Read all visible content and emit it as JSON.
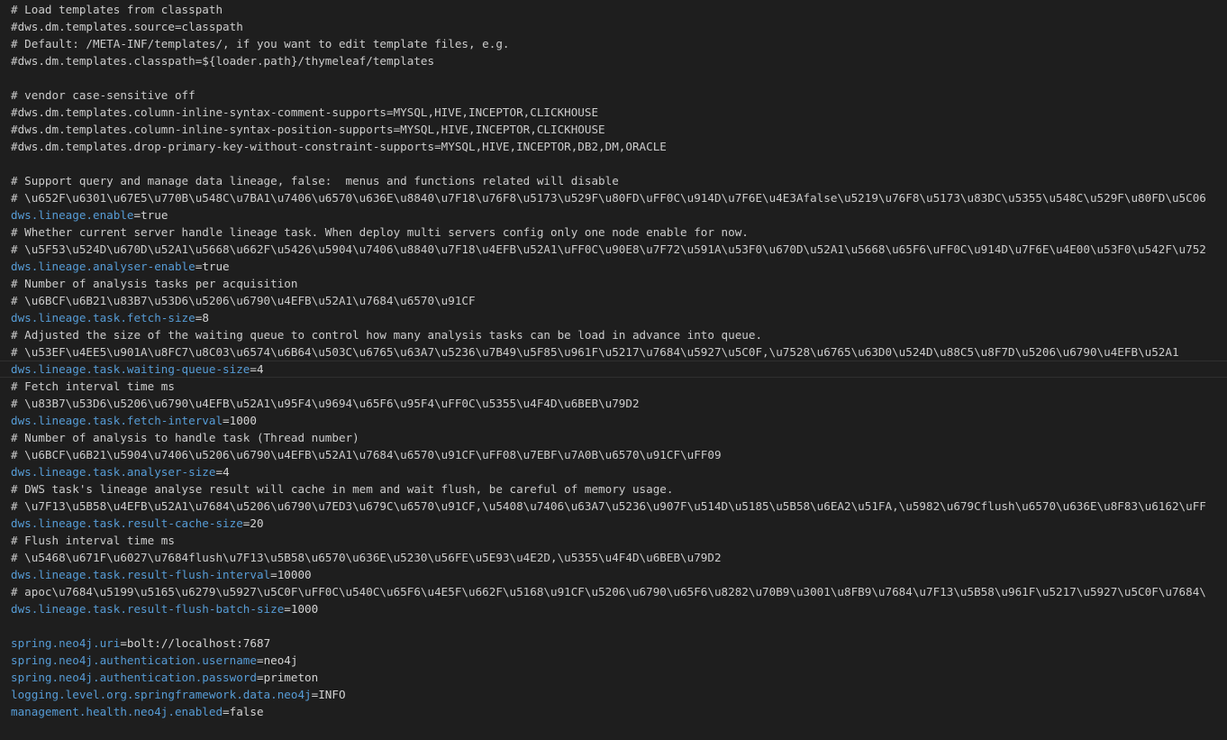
{
  "editor": {
    "colors": {
      "background": "#1e1e1e",
      "comment": "#cccccc",
      "key": "#569cd6",
      "value": "#d4d4d4"
    },
    "lines": [
      {
        "type": "comment",
        "text": "# Load templates from classpath"
      },
      {
        "type": "comment",
        "text": "#dws.dm.templates.source=classpath"
      },
      {
        "type": "comment",
        "text": "# Default: /META-INF/templates/, if you want to edit template files, e.g."
      },
      {
        "type": "comment",
        "text": "#dws.dm.templates.classpath=${loader.path}/thymeleaf/templates"
      },
      {
        "type": "blank",
        "text": ""
      },
      {
        "type": "comment",
        "text": "# vendor case-sensitive off"
      },
      {
        "type": "comment",
        "text": "#dws.dm.templates.column-inline-syntax-comment-supports=MYSQL,HIVE,INCEPTOR,CLICKHOUSE"
      },
      {
        "type": "comment",
        "text": "#dws.dm.templates.column-inline-syntax-position-supports=MYSQL,HIVE,INCEPTOR,CLICKHOUSE"
      },
      {
        "type": "comment",
        "text": "#dws.dm.templates.drop-primary-key-without-constraint-supports=MYSQL,HIVE,INCEPTOR,DB2,DM,ORACLE"
      },
      {
        "type": "blank",
        "text": ""
      },
      {
        "type": "comment",
        "text": "# Support query and manage data lineage, false:  menus and functions related will disable"
      },
      {
        "type": "comment",
        "text": "# \\u652F\\u6301\\u67E5\\u770B\\u548C\\u7BA1\\u7406\\u6570\\u636E\\u8840\\u7F18\\u76F8\\u5173\\u529F\\u80FD\\uFF0C\\u914D\\u7F6E\\u4E3Afalse\\u5219\\u76F8\\u5173\\u83DC\\u5355\\u548C\\u529F\\u80FD\\u5C06"
      },
      {
        "type": "prop",
        "key": "dws.lineage.enable",
        "value": "true"
      },
      {
        "type": "comment",
        "text": "# Whether current server handle lineage task. When deploy multi servers config only one node enable for now."
      },
      {
        "type": "comment",
        "text": "# \\u5F53\\u524D\\u670D\\u52A1\\u5668\\u662F\\u5426\\u5904\\u7406\\u8840\\u7F18\\u4EFB\\u52A1\\uFF0C\\u90E8\\u7F72\\u591A\\u53F0\\u670D\\u52A1\\u5668\\u65F6\\uFF0C\\u914D\\u7F6E\\u4E00\\u53F0\\u542F\\u752"
      },
      {
        "type": "prop",
        "key": "dws.lineage.analyser-enable",
        "value": "true"
      },
      {
        "type": "comment",
        "text": "# Number of analysis tasks per acquisition"
      },
      {
        "type": "comment",
        "text": "# \\u6BCF\\u6B21\\u83B7\\u53D6\\u5206\\u6790\\u4EFB\\u52A1\\u7684\\u6570\\u91CF"
      },
      {
        "type": "prop",
        "key": "dws.lineage.task.fetch-size",
        "value": "8"
      },
      {
        "type": "comment",
        "text": "# Adjusted the size of the waiting queue to control how many analysis tasks can be load in advance into queue."
      },
      {
        "type": "comment",
        "text": "# \\u53EF\\u4EE5\\u901A\\u8FC7\\u8C03\\u6574\\u6B64\\u503C\\u6765\\u63A7\\u5236\\u7B49\\u5F85\\u961F\\u5217\\u7684\\u5927\\u5C0F,\\u7528\\u6765\\u63D0\\u524D\\u88C5\\u8F7D\\u5206\\u6790\\u4EFB\\u52A1"
      },
      {
        "type": "prop",
        "key": "dws.lineage.task.waiting-queue-size",
        "value": "4",
        "current": true
      },
      {
        "type": "comment",
        "text": "# Fetch interval time ms"
      },
      {
        "type": "comment",
        "text": "# \\u83B7\\u53D6\\u5206\\u6790\\u4EFB\\u52A1\\u95F4\\u9694\\u65F6\\u95F4\\uFF0C\\u5355\\u4F4D\\u6BEB\\u79D2"
      },
      {
        "type": "prop",
        "key": "dws.lineage.task.fetch-interval",
        "value": "1000"
      },
      {
        "type": "comment",
        "text": "# Number of analysis to handle task (Thread number)"
      },
      {
        "type": "comment",
        "text": "# \\u6BCF\\u6B21\\u5904\\u7406\\u5206\\u6790\\u4EFB\\u52A1\\u7684\\u6570\\u91CF\\uFF08\\u7EBF\\u7A0B\\u6570\\u91CF\\uFF09"
      },
      {
        "type": "prop",
        "key": "dws.lineage.task.analyser-size",
        "value": "4"
      },
      {
        "type": "comment",
        "text": "# DWS task's lineage analyse result will cache in mem and wait flush, be careful of memory usage."
      },
      {
        "type": "comment",
        "text": "# \\u7F13\\u5B58\\u4EFB\\u52A1\\u7684\\u5206\\u6790\\u7ED3\\u679C\\u6570\\u91CF,\\u5408\\u7406\\u63A7\\u5236\\u907F\\u514D\\u5185\\u5B58\\u6EA2\\u51FA,\\u5982\\u679Cflush\\u6570\\u636E\\u8F83\\u6162\\uFF"
      },
      {
        "type": "prop",
        "key": "dws.lineage.task.result-cache-size",
        "value": "20"
      },
      {
        "type": "comment",
        "text": "# Flush interval time ms"
      },
      {
        "type": "comment",
        "text": "# \\u5468\\u671F\\u6027\\u7684flush\\u7F13\\u5B58\\u6570\\u636E\\u5230\\u56FE\\u5E93\\u4E2D,\\u5355\\u4F4D\\u6BEB\\u79D2"
      },
      {
        "type": "prop",
        "key": "dws.lineage.task.result-flush-interval",
        "value": "10000"
      },
      {
        "type": "comment",
        "text": "# apoc\\u7684\\u5199\\u5165\\u6279\\u5927\\u5C0F\\uFF0C\\u540C\\u65F6\\u4E5F\\u662F\\u5168\\u91CF\\u5206\\u6790\\u65F6\\u8282\\u70B9\\u3001\\u8FB9\\u7684\\u7F13\\u5B58\\u961F\\u5217\\u5927\\u5C0F\\u7684\\"
      },
      {
        "type": "prop",
        "key": "dws.lineage.task.result-flush-batch-size",
        "value": "1000"
      },
      {
        "type": "blank",
        "text": ""
      },
      {
        "type": "prop",
        "key": "spring.neo4j.uri",
        "value": "bolt://localhost:7687"
      },
      {
        "type": "prop",
        "key": "spring.neo4j.authentication.username",
        "value": "neo4j"
      },
      {
        "type": "prop",
        "key": "spring.neo4j.authentication.password",
        "value": "primeton"
      },
      {
        "type": "prop",
        "key": "logging.level.org.springframework.data.neo4j",
        "value": "INFO"
      },
      {
        "type": "prop",
        "key": "management.health.neo4j.enabled",
        "value": "false"
      }
    ]
  }
}
